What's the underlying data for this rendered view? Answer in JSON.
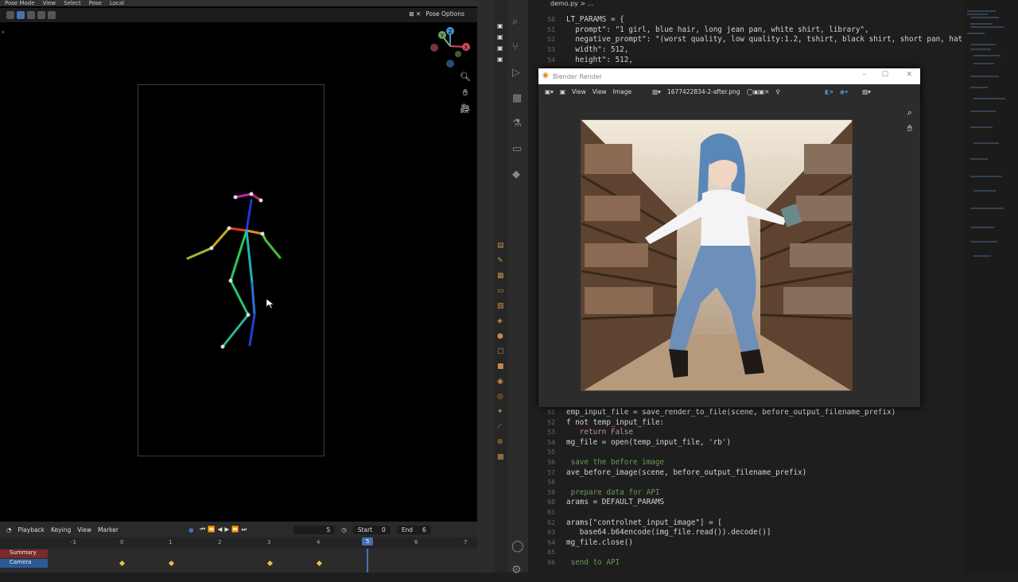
{
  "blender": {
    "top_menu": [
      "Pose Mode",
      "View",
      "Select",
      "Pose",
      "Local"
    ],
    "pose_options": "Pose Options",
    "timeline": {
      "menus": [
        "Playback",
        "Keying",
        "View",
        "Marker"
      ],
      "current_frame": "5",
      "start_label": "Start",
      "start_value": "0",
      "end_label": "End",
      "end_value": "6",
      "ruler": [
        "-1",
        "0",
        "1",
        "2",
        "3",
        "4",
        "5",
        "6",
        "7"
      ],
      "channels": [
        "Summary",
        "Camera"
      ]
    },
    "gizmo_labels": [
      "X",
      "Y",
      "Z"
    ]
  },
  "vscode": {
    "breadcrumb": "demo.py > ...",
    "colors": {
      "keyword": "#c586c0",
      "string": "#ce9178",
      "number": "#b5cea8",
      "comment": "#6a9955",
      "func": "#dcdcaa"
    },
    "top_lines": [
      {
        "n": "50",
        "t": "LT_PARAMS = {"
      },
      {
        "n": "51",
        "t": "  prompt\": \"1 girl, blue hair, long jean pan, white shirt, library\","
      },
      {
        "n": "52",
        "t": "  negative_prompt\": \"(worst quality, low quality:1.2, tshirt, black shirt, short pan, hat, skirt),"
      },
      {
        "n": "53",
        "t": "  width\": 512,"
      },
      {
        "n": "54",
        "t": "  height\": 512,"
      }
    ],
    "bottom_lines": [
      {
        "n": "51",
        "t": "emp_input_file = save_render_to_file(scene, before_output_filename_prefix)"
      },
      {
        "n": "52",
        "t": "f not temp_input_file:"
      },
      {
        "n": "53",
        "t": "   return False"
      },
      {
        "n": "54",
        "t": "mg_file = open(temp_input_file, 'rb')"
      },
      {
        "n": "55",
        "t": ""
      },
      {
        "n": "56",
        "t": " save the before image"
      },
      {
        "n": "57",
        "t": "ave_before_image(scene, before_output_filename_prefix)"
      },
      {
        "n": "58",
        "t": ""
      },
      {
        "n": "59",
        "t": " prepare data for API"
      },
      {
        "n": "60",
        "t": "arams = DEFAULT_PARAMS"
      },
      {
        "n": "61",
        "t": ""
      },
      {
        "n": "62",
        "t": "arams[\"controlnet_input_image\"] = ["
      },
      {
        "n": "63",
        "t": "   base64.b64encode(img_file.read()).decode()]"
      },
      {
        "n": "64",
        "t": "mg_file.close()"
      },
      {
        "n": "65",
        "t": ""
      },
      {
        "n": "66",
        "t": " send to API"
      }
    ]
  },
  "render_window": {
    "title": "Blender Render",
    "menus": [
      "View",
      "View",
      "Image"
    ],
    "filename": "1677422834-2-after.png",
    "controls": [
      "–",
      "☐",
      "✕"
    ]
  }
}
